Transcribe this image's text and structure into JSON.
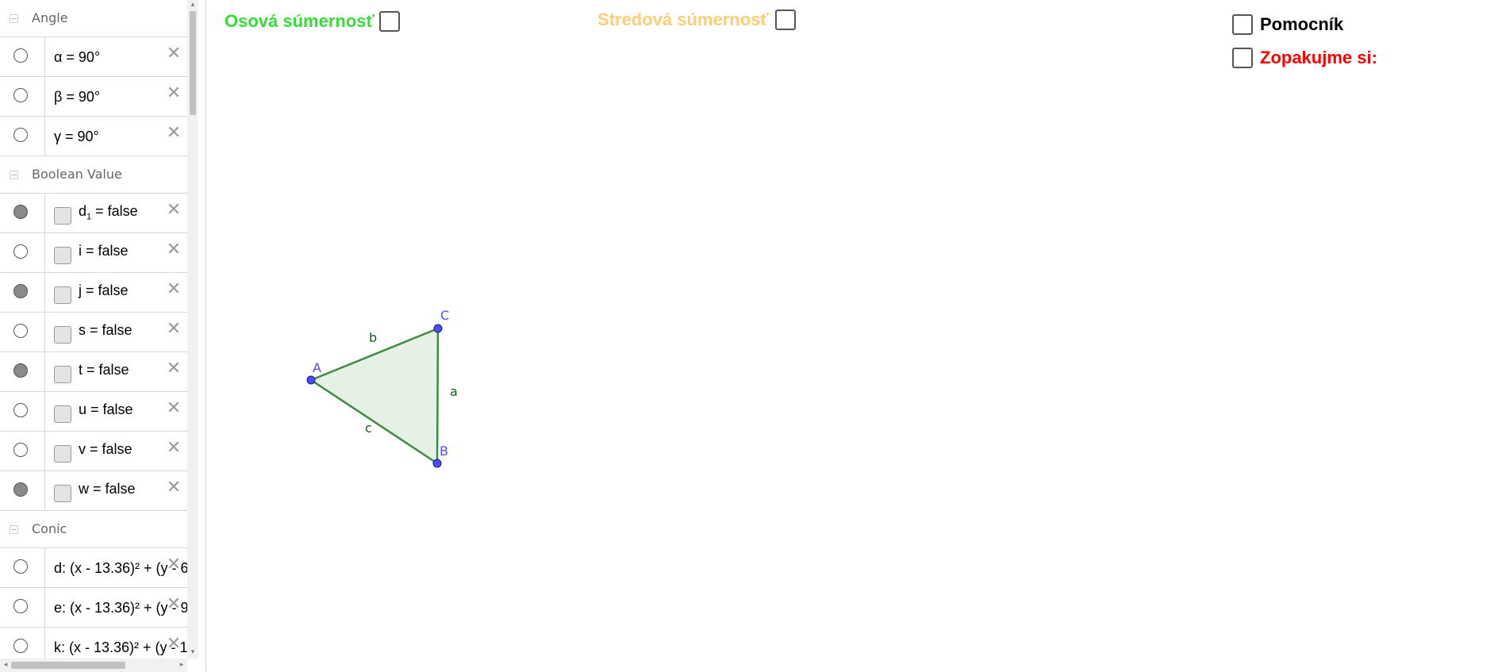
{
  "algebra": {
    "groups": {
      "angle": "Angle",
      "boolean": "Boolean Value",
      "conic": "Conic"
    },
    "angles": [
      {
        "text": "α = 90°",
        "visible": false
      },
      {
        "text": "β = 90°",
        "visible": false
      },
      {
        "text": "γ = 90°",
        "visible": false
      }
    ],
    "booleans": [
      {
        "name": "d",
        "sub": "1",
        "rest": " = false",
        "visible": true
      },
      {
        "text": "i = false",
        "visible": false
      },
      {
        "text": "j = false",
        "visible": true
      },
      {
        "text": "s = false",
        "visible": false
      },
      {
        "text": "t = false",
        "visible": true
      },
      {
        "text": "u = false",
        "visible": false
      },
      {
        "text": "v = false",
        "visible": false
      },
      {
        "text": "w = false",
        "visible": true
      }
    ],
    "conics": [
      {
        "text": "d: (x - 13.36)² + (y - 6",
        "visible": false
      },
      {
        "text": "e: (x - 13.36)² + (y - 9",
        "visible": false
      },
      {
        "text": "k: (x - 13.36)² + (y - 1",
        "visible": false
      }
    ],
    "delete_glyph": "✕",
    "collapse_glyph": "−"
  },
  "graphics": {
    "checkboxes": {
      "osova": {
        "label": "Osová súmernosť",
        "color": "#33dd33",
        "checked": false
      },
      "stredova": {
        "label": "Stredová súmernosť",
        "color": "#ffcc77",
        "checked": false
      },
      "pomocnik": {
        "label": "Pomocník",
        "color": "#000000",
        "checked": false
      },
      "zopakujme": {
        "label": "Zopakujme si:",
        "color": "#ff0000",
        "checked": false
      }
    },
    "triangle": {
      "points": {
        "A": "A",
        "B": "B",
        "C": "C"
      },
      "segments": {
        "a": "a",
        "b": "b",
        "c": "c"
      },
      "fill_color": "#2e8b2e",
      "point_color": "#4d4dff"
    }
  }
}
